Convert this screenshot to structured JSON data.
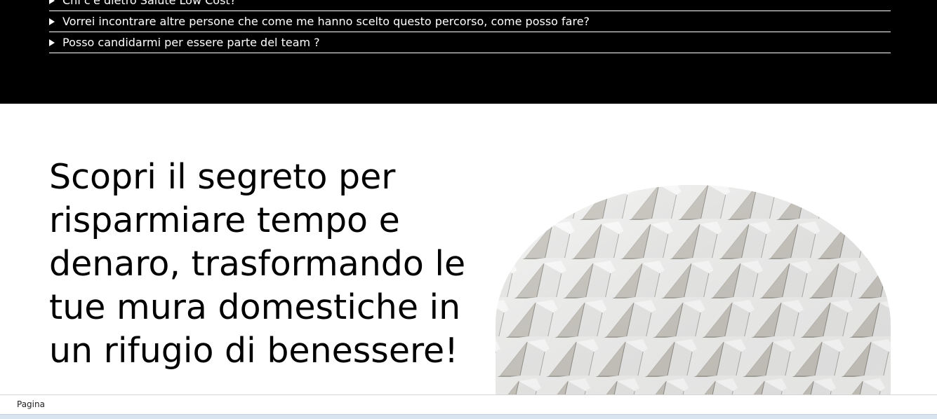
{
  "faq": {
    "items": [
      {
        "question": "Chi c'è dietro Salute Low Cost?"
      },
      {
        "question": "Vorrei incontrare altre persone che come me hanno scelto questo percorso, come posso fare?"
      },
      {
        "question": "Posso candidarmi per essere parte del team ?"
      }
    ]
  },
  "hero": {
    "title": "Scopri il segreto per risparmiare tempo e denaro, trasformando le tue mura domestiche in un rifugio di benessere!"
  },
  "statusbar": {
    "label": "Pagina"
  },
  "colors": {
    "faq_background": "#000000",
    "faq_text": "#ffffff",
    "page_background": "#ffffff",
    "title_text": "#000000"
  }
}
